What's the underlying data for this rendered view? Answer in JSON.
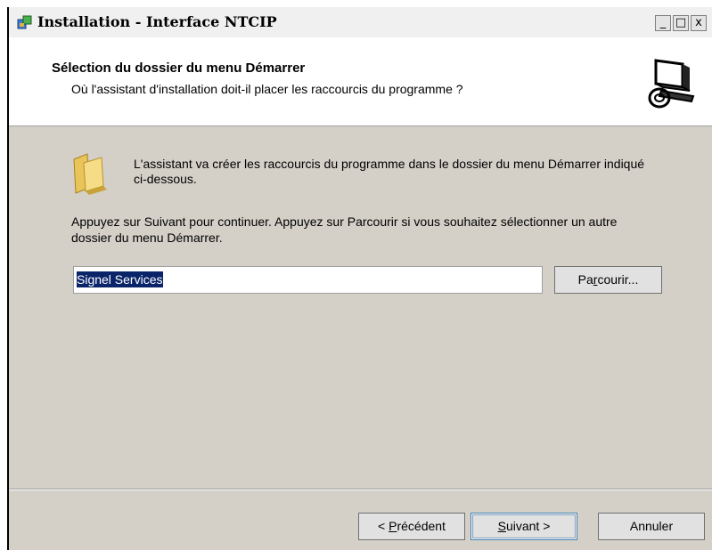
{
  "window": {
    "title": "Installation - Interface NTCIP",
    "controls": {
      "minimize": "_",
      "maximize": "□",
      "close": "x"
    }
  },
  "header": {
    "title": "Sélection du dossier du menu Démarrer",
    "subtitle": "Où l'assistant d'installation doit-il placer les raccourcis du programme ?"
  },
  "body": {
    "intro": "L'assistant va créer les raccourcis du programme dans le dossier du menu Démarrer indiqué ci-dessous.",
    "instructions": "Appuyez sur Suivant pour continuer. Appuyez sur Parcourir si vous souhaitez sélectionner un autre dossier du menu Démarrer.",
    "folder_value": "Signel Services",
    "browse": {
      "pre": "Pa",
      "accel": "r",
      "post": "courir..."
    }
  },
  "footer": {
    "back": {
      "pre": "< ",
      "accel": "P",
      "post": "récédent"
    },
    "next": {
      "pre": "",
      "accel": "S",
      "post": "uivant >"
    },
    "cancel": "Annuler"
  },
  "colors": {
    "dialog_bg": "#d4d0c8",
    "header_bg": "#ffffff",
    "selection": "#0a246a"
  }
}
